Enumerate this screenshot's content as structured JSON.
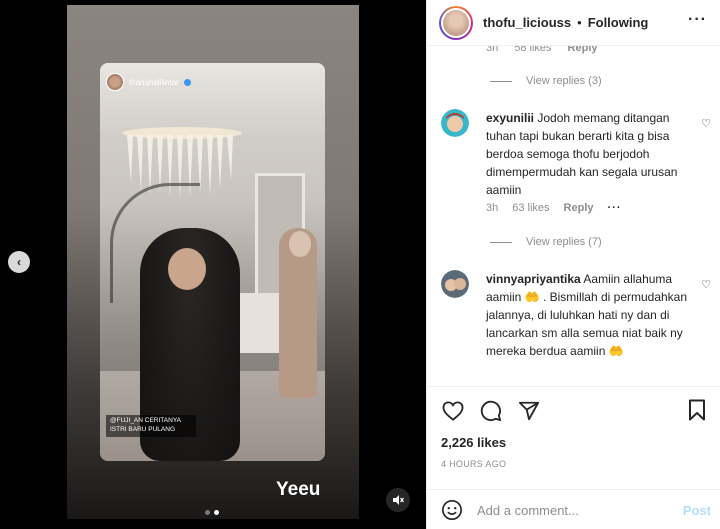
{
  "story": {
    "username": "thariqhalilintar",
    "tag_text": "@FUJI_AN  CERITANYA ISTRI BARU PULANG",
    "caption": "Yeeu"
  },
  "carousel": {
    "total": 2,
    "active": 2
  },
  "post_header": {
    "username": "thofu_liciouss",
    "separator": "•",
    "follow_status": "Following",
    "more": "···"
  },
  "comments": {
    "partial": {
      "time": "3h",
      "likes": "58 likes",
      "reply": "Reply"
    },
    "view_replies_1": "View replies (3)",
    "items": [
      {
        "username": "exyunilii",
        "text": "Jodoh memang ditangan tuhan tapi bukan berarti kita g bisa berdoa semoga thofu berjodoh dimempermudah kan segala urusan aamiin",
        "time": "3h",
        "likes": "63 likes",
        "reply": "Reply",
        "more": "···"
      },
      {
        "username": "vinnyapriyantika",
        "text": "Aamiin allahuma aamiin 🤲 . Bismillah di permudahkan jalannya, di luluhkan hati ny dan di lancarkan sm alla semua niat baik ny mereka berdua aamiin 🤲"
      }
    ],
    "view_replies_2": "View replies (7)"
  },
  "actions": {
    "likes": "2,226 likes",
    "time": "4 HOURS AGO",
    "comment_placeholder": "Add a comment...",
    "post_label": "Post"
  },
  "colors": {
    "accent_link": "#b2dffc",
    "secondary_text": "#8e8e8e",
    "primary_text": "#262626",
    "verified": "#3897f0"
  }
}
